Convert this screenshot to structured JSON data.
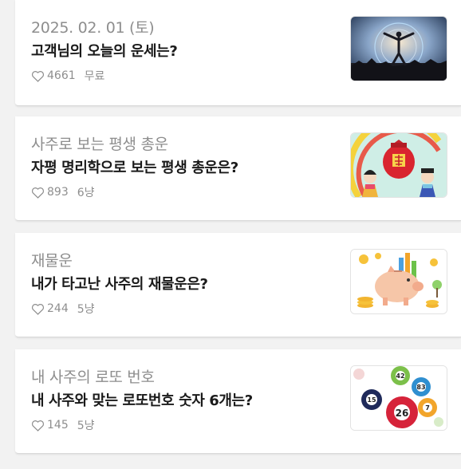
{
  "items": [
    {
      "subtitle": "2025. 02. 01 (토)",
      "title": "고객님의 오늘의 운세는?",
      "likes": "4661",
      "price": "무료",
      "thumbnail": "meditation-silhouette-sunset"
    },
    {
      "subtitle": "사주로 보는 평생 총운",
      "title": "자평 명리학으로 보는 평생 총운은?",
      "likes": "893",
      "price": "6냥",
      "thumbnail": "lucky-bag-hanbok-children"
    },
    {
      "subtitle": "재물운",
      "title": "내가 타고난 사주의 재물운은?",
      "likes": "244",
      "price": "5냥",
      "thumbnail": "piggy-bank-coins"
    },
    {
      "subtitle": "내 사주의 로또 번호",
      "title": "내 사주와 맞는 로또번호 숫자 6개는?",
      "likes": "145",
      "price": "5냥",
      "thumbnail": "lottery-balls"
    }
  ],
  "lotto_balls": [
    "42",
    "83",
    "15",
    "7",
    "26"
  ],
  "colors": {
    "subtitle": "#8e8e8e",
    "title": "#1a1a1a",
    "meta": "#8e8e8e",
    "background": "#f2f2f2"
  }
}
